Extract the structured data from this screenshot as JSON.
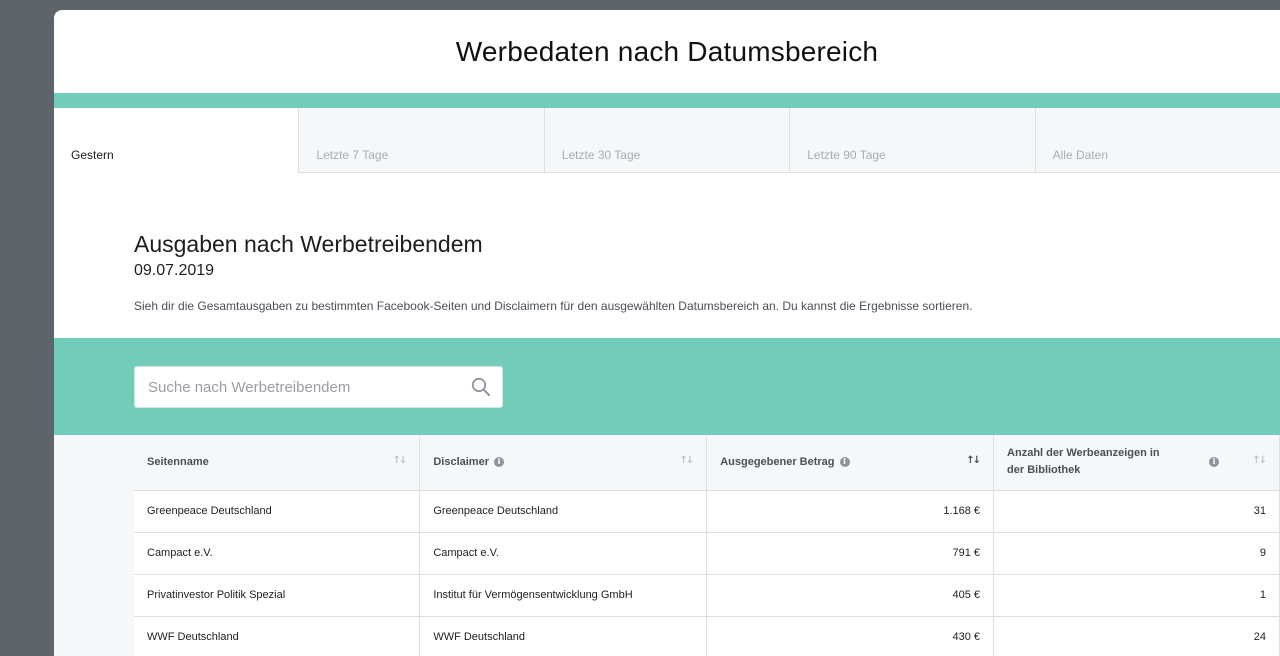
{
  "window": {
    "title": "Werbedaten nach Datumsbereich"
  },
  "tabs": [
    {
      "label": "Gestern",
      "active": true
    },
    {
      "label": "Letzte 7 Tage",
      "active": false
    },
    {
      "label": "Letzte 30 Tage",
      "active": false
    },
    {
      "label": "Letzte 90 Tage",
      "active": false
    },
    {
      "label": "Alle Daten",
      "active": false
    }
  ],
  "section": {
    "title": "Ausgaben nach Werbetreibendem",
    "date": "09.07.2019",
    "description": "Sieh dir die Gesamtausgaben zu bestimmten Facebook-Seiten und Disclaimern für den ausgewählten Datumsbereich an. Du kannst die Ergebnisse sortieren."
  },
  "search": {
    "placeholder": "Suche nach Werbetreibendem",
    "value": ""
  },
  "table": {
    "headers": [
      {
        "label": "Seitenname",
        "info": false,
        "sort_active": false
      },
      {
        "label": "Disclaimer",
        "info": true,
        "sort_active": false
      },
      {
        "label": "Ausgegebener Betrag",
        "info": true,
        "sort_active": true
      },
      {
        "label": "Anzahl der Werbeanzeigen in der Bibliothek",
        "info": true,
        "sort_active": false
      }
    ],
    "rows": [
      {
        "page": "Greenpeace Deutschland",
        "disclaimer": "Greenpeace Deutschland",
        "amount": "1.168 €",
        "count": "31"
      },
      {
        "page": "Campact e.V.",
        "disclaimer": "Campact e.V.",
        "amount": "791 €",
        "count": "9"
      },
      {
        "page": "Privatinvestor Politik Spezial",
        "disclaimer": "Institut für Vermögensentwicklung GmbH",
        "amount": "405 €",
        "count": "1"
      },
      {
        "page": "WWF Deutschland",
        "disclaimer": "WWF Deutschland",
        "amount": "430 €",
        "count": "24"
      }
    ]
  },
  "colors": {
    "accent": "#71cdb9",
    "background": "#5f646b",
    "table_bg": "#f6f7f8"
  },
  "icons": {
    "search": "search-icon",
    "info": "info-icon",
    "sort": "sort-icon"
  }
}
